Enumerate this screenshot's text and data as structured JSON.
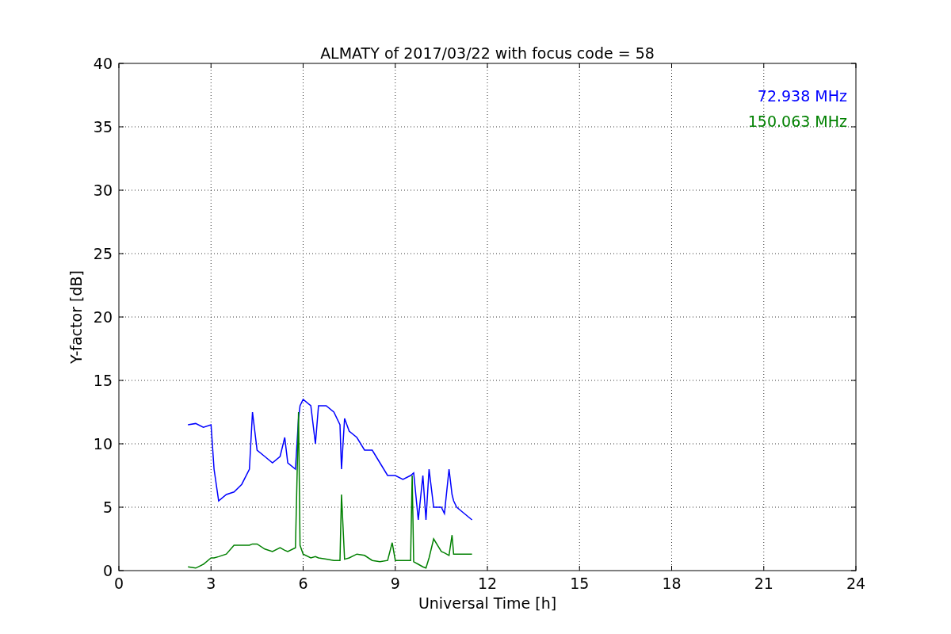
{
  "figure": {
    "chart_data": {
      "type": "line",
      "title": "ALMATY of 2017/03/22 with focus code = 58",
      "xlabel": "Universal Time [h]",
      "ylabel": "Y-factor [dB]",
      "x": [
        2.25,
        2.5,
        2.75,
        3.0,
        3.1,
        3.25,
        3.5,
        3.75,
        4.0,
        4.25,
        4.35,
        4.5,
        4.75,
        5.0,
        5.25,
        5.4,
        5.5,
        5.75,
        5.85,
        5.9,
        6.0,
        6.25,
        6.4,
        6.5,
        6.75,
        7.0,
        7.2,
        7.25,
        7.35,
        7.5,
        7.75,
        8.0,
        8.25,
        8.5,
        8.75,
        8.9,
        9.0,
        9.25,
        9.5,
        9.55,
        9.6,
        9.75,
        9.9,
        10.0,
        10.1,
        10.25,
        10.5,
        10.6,
        10.75,
        10.85,
        10.9,
        11.0,
        11.25,
        11.5
      ],
      "series": [
        {
          "name": "72.938 MHz",
          "color": "#0000ff",
          "values": [
            11.5,
            11.6,
            11.3,
            11.5,
            8,
            5.5,
            6.0,
            6.2,
            6.8,
            8,
            12.5,
            9.5,
            9.0,
            8.5,
            9,
            10.5,
            8.5,
            8,
            12,
            13,
            13.5,
            13,
            10,
            13,
            13,
            12.5,
            11.5,
            8,
            12,
            11,
            10.5,
            9.5,
            9.5,
            8.5,
            7.5,
            7.5,
            7.5,
            7.2,
            7.5,
            7.6,
            7.7,
            4,
            7.5,
            4,
            8,
            5,
            5,
            4.5,
            8,
            6,
            5.5,
            5,
            4.5,
            4
          ]
        },
        {
          "name": "150.063 MHz",
          "color": "#008000",
          "values": [
            0.3,
            0.2,
            0.5,
            1.0,
            1.0,
            1.1,
            1.3,
            2.0,
            2.0,
            2.0,
            2.1,
            2.1,
            1.7,
            1.5,
            1.8,
            1.6,
            1.5,
            1.8,
            12.5,
            2.0,
            1.3,
            1.0,
            1.1,
            1.0,
            0.9,
            0.8,
            0.8,
            6,
            0.9,
            1.0,
            1.3,
            1.2,
            0.8,
            0.7,
            0.8,
            2.2,
            0.8,
            0.8,
            0.8,
            7.5,
            0.7,
            0.5,
            0.3,
            0.2,
            1.0,
            2.5,
            1.5,
            1.4,
            1.2,
            2.8,
            1.3,
            1.3,
            1.3,
            1.3
          ]
        }
      ],
      "xlim": [
        0,
        24
      ],
      "ylim": [
        0,
        40
      ],
      "xticks": [
        0,
        3,
        6,
        9,
        12,
        15,
        18,
        21,
        24
      ],
      "yticks": [
        0,
        5,
        10,
        15,
        20,
        25,
        30,
        35,
        40
      ],
      "grid": true
    }
  }
}
